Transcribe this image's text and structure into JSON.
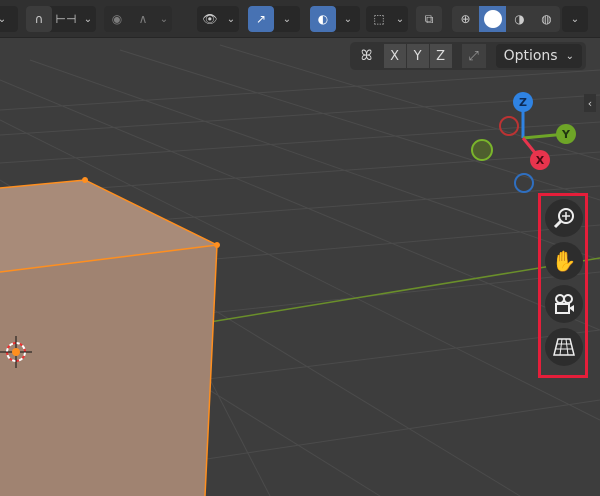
{
  "header": {
    "toolbar_items": [
      {
        "name": "snap-toggle",
        "icon": "magnet-icon"
      },
      {
        "name": "snap-target",
        "icon": "snap-increment-icon"
      },
      {
        "name": "proportional-editing",
        "icon": "proportional-icon"
      },
      {
        "name": "falloff",
        "icon": "falloff-curve-icon"
      },
      {
        "name": "visibility",
        "icon": "eye-icon"
      },
      {
        "name": "gizmos",
        "icon": "gizmo-icon",
        "active": true
      },
      {
        "name": "overlays",
        "icon": "overlay-icon",
        "active": true
      },
      {
        "name": "mesh-edit-overlays",
        "icon": "mesh-select-icon"
      },
      {
        "name": "xray",
        "icon": "xray-icon"
      },
      {
        "name": "shading-wireframe",
        "icon": "wireframe-sphere-icon"
      },
      {
        "name": "shading-solid",
        "icon": "solid-sphere-icon",
        "active": true
      },
      {
        "name": "shading-material",
        "icon": "material-sphere-icon"
      },
      {
        "name": "shading-rendered",
        "icon": "rendered-sphere-icon"
      }
    ],
    "mirror": {
      "x": "X",
      "y": "Y",
      "z": "Z"
    },
    "options_label": "Options"
  },
  "gizmo": {
    "x": "X",
    "y": "Y",
    "z": "Z"
  },
  "colors": {
    "x": "#e8344d",
    "y": "#6ea527",
    "z": "#2f83e3",
    "highlight": "#e51e3a",
    "selected": "#ff8f1f",
    "active_tool": "#4772b3"
  },
  "nav_buttons": [
    "zoom",
    "pan",
    "camera",
    "ortho-perspective"
  ],
  "collapse_glyph": "‹"
}
